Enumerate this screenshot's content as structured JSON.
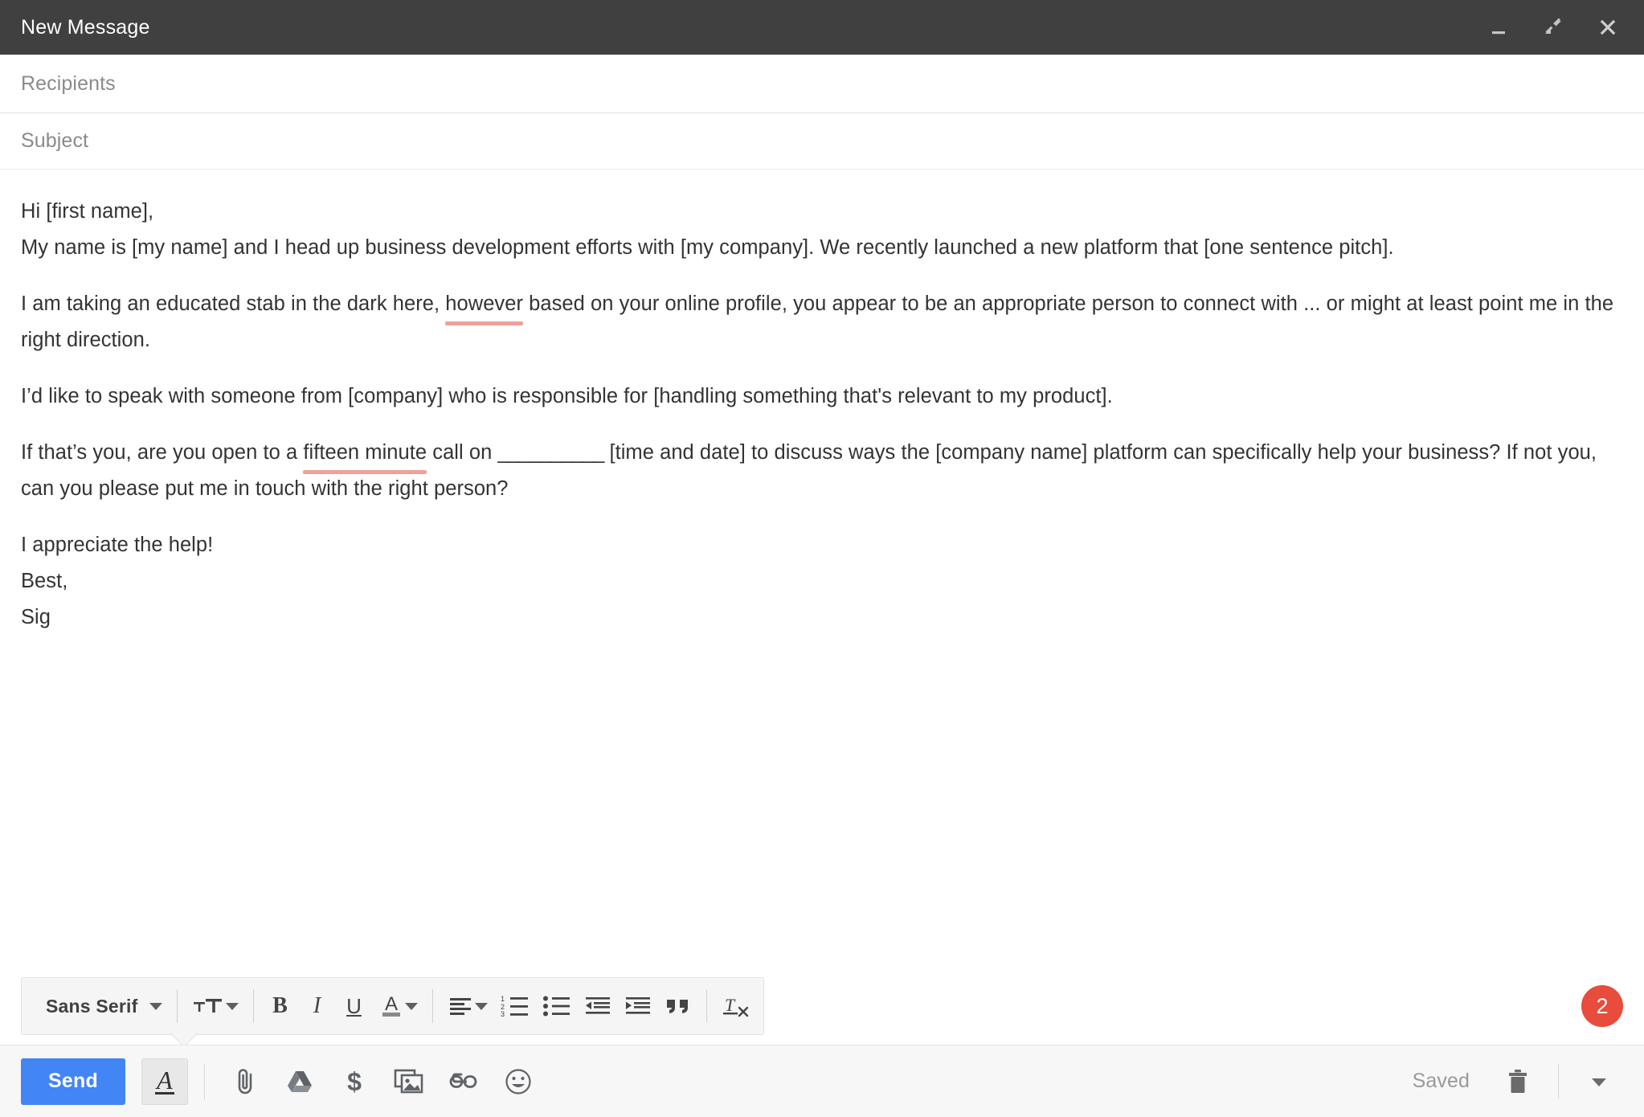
{
  "window": {
    "title": "New Message",
    "controls": [
      {
        "name": "minimize",
        "icon": "minimize-icon"
      },
      {
        "name": "minimize-restore",
        "icon": "collapse-arrows-icon"
      },
      {
        "name": "close",
        "icon": "close-icon"
      }
    ]
  },
  "fields": {
    "recipients_placeholder": "Recipients",
    "recipients_value": "",
    "subject_placeholder": "Subject",
    "subject_value": ""
  },
  "body": {
    "greeting": "Hi [first name],",
    "p1": "My name is [my name] and I head up business development efforts with [my company]. We recently launched a new platform that [one sentence pitch].",
    "p2_before": "I am taking an educated stab in the dark here, ",
    "p2_spell": "however",
    "p2_after": " based on your online profile, you appear to be an appropriate person to connect with ... or might at least point me in the right direction.",
    "p3": "I’d like to speak with someone from [company] who is responsible for [handling something that's relevant to my product].",
    "p4_before": "If that’s you, are you open to a ",
    "p4_spell": "fifteen minute",
    "p4_mid": " call on ",
    "p4_blank": "__________",
    "p4_after": " [time and date] to discuss ways the [company name] platform can specifically help your business? If not you, can you please put me in touch with the right person?",
    "closing1": "I appreciate the help!",
    "closing2": "Best,",
    "closing3": "Sig"
  },
  "toolbar": {
    "font_name": "Sans Serif",
    "items": [
      {
        "name": "font-family-selector",
        "label": "Sans Serif",
        "icon": "chevron-down-icon"
      },
      {
        "name": "font-size-button",
        "icon": "text-size-icon"
      },
      {
        "name": "bold-button",
        "icon": "bold-icon",
        "glyph": "B"
      },
      {
        "name": "italic-button",
        "icon": "italic-icon",
        "glyph": "I"
      },
      {
        "name": "underline-button",
        "icon": "underline-icon",
        "glyph": "U"
      },
      {
        "name": "text-color-button",
        "icon": "text-color-icon",
        "glyph": "A"
      },
      {
        "name": "align-button",
        "icon": "align-left-icon"
      },
      {
        "name": "numbered-list-button",
        "icon": "numbered-list-icon"
      },
      {
        "name": "bulleted-list-button",
        "icon": "bulleted-list-icon"
      },
      {
        "name": "outdent-button",
        "icon": "outdent-icon"
      },
      {
        "name": "indent-button",
        "icon": "indent-icon"
      },
      {
        "name": "quote-button",
        "icon": "quote-icon"
      },
      {
        "name": "remove-formatting-button",
        "icon": "remove-formatting-icon"
      }
    ]
  },
  "badge": {
    "count": "2",
    "color": "#e74c3c"
  },
  "bottom": {
    "send_label": "Send",
    "send_color": "#4285f4",
    "saved_label": "Saved",
    "actions": [
      {
        "name": "formatting-options",
        "icon": "format-text-icon"
      },
      {
        "name": "attach-files",
        "icon": "paperclip-icon"
      },
      {
        "name": "insert-drive-files",
        "icon": "google-drive-icon"
      },
      {
        "name": "insert-money",
        "icon": "dollar-icon"
      },
      {
        "name": "insert-photo",
        "icon": "image-icon"
      },
      {
        "name": "insert-link",
        "icon": "link-icon"
      },
      {
        "name": "insert-emoji",
        "icon": "emoji-icon"
      },
      {
        "name": "discard-draft",
        "icon": "trash-icon"
      },
      {
        "name": "more-options",
        "icon": "chevron-down-icon"
      }
    ]
  }
}
